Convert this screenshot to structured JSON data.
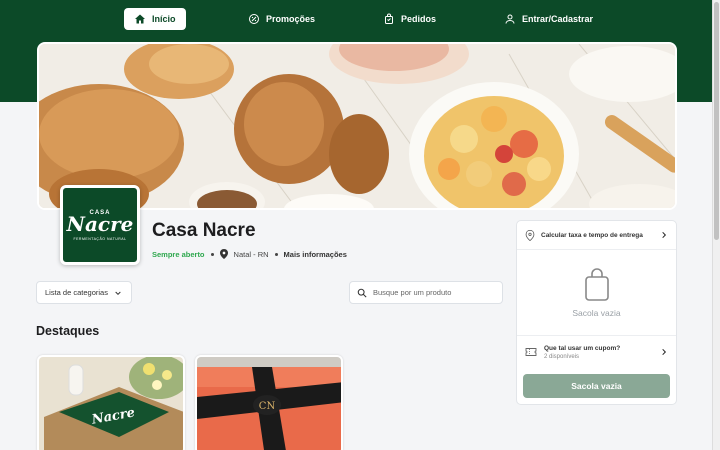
{
  "nav": {
    "items": [
      {
        "label": "Início",
        "icon": "home-icon",
        "active": true
      },
      {
        "label": "Promoções",
        "icon": "discount-icon",
        "active": false
      },
      {
        "label": "Pedidos",
        "icon": "bag-icon",
        "active": false
      },
      {
        "label": "Entrar/Cadastrar",
        "icon": "user-icon",
        "active": false
      }
    ]
  },
  "store": {
    "logo_small": "CASA",
    "logo_big": "Nacre",
    "logo_tagline": "FERMENTAÇÃO NATURAL",
    "name": "Casa Nacre",
    "status": "Sempre aberto",
    "location": "Natal - RN",
    "more_info": "Mais informações"
  },
  "filters": {
    "category_label": "Lista de categorias",
    "search_placeholder": "Busque por um produto"
  },
  "featured": {
    "title": "Destaques"
  },
  "cart": {
    "delivery_label": "Calcular taxa e tempo de entrega",
    "empty_label": "Sacola vazia",
    "coupon_title": "Que tal usar um cupom?",
    "coupon_sub": "2 disponíveis",
    "button_label": "Sacola vazia"
  },
  "colors": {
    "brand_green": "#0c4a28",
    "open_green": "#2fa84f",
    "cart_button": "#8aa896"
  }
}
